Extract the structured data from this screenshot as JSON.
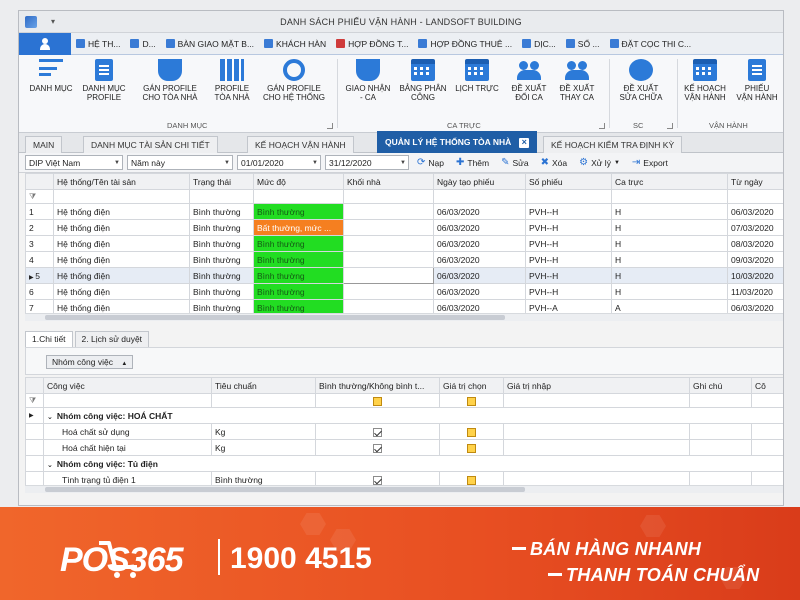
{
  "window": {
    "title": "DANH SÁCH PHIẾU VẬN HÀNH - LANDSOFT BUILDING"
  },
  "ribbon_tabs": [
    {
      "label": "HỆ TH..."
    },
    {
      "label": "D..."
    },
    {
      "label": "BÀN GIAO MẶT B..."
    },
    {
      "label": "KHÁCH HÀN"
    },
    {
      "label": "HỢP ĐỒNG T..."
    },
    {
      "label": "HỢP ĐỒNG THUÊ ..."
    },
    {
      "label": "DỊC..."
    },
    {
      "label": "SỔ ..."
    },
    {
      "label": "ĐẶT CỌC THI C..."
    }
  ],
  "ribbon": {
    "danh_muc": "DANH MỤC",
    "danh_muc_profile": [
      "DANH MỤC",
      "PROFILE"
    ],
    "gan_profile_toa_nha": [
      "GÁN PROFILE",
      "CHO TÒA NHÀ"
    ],
    "profile_toa_nha": [
      "PROFILE",
      "TÒA NHÀ"
    ],
    "gan_profile_he_thong": [
      "GÁN PROFILE",
      "CHO HỆ THỐNG"
    ],
    "giao_nhan_ca": [
      "GIAO NHẬN",
      "- CA"
    ],
    "bang_phan_cong": [
      "BẢNG PHÂN",
      "CÔNG"
    ],
    "lich_truc": "LỊCH TRỰC",
    "de_xuat_doi_ca": [
      "ĐỀ XUẤT",
      "ĐỔI CA"
    ],
    "de_xuat_thay_ca": [
      "ĐỀ XUẤT",
      "THAY CA"
    ],
    "de_xuat_sua_chua": [
      "ĐỀ XUẤT",
      "SỬA CHỮA"
    ],
    "ke_hoach_van_hanh": [
      "KẾ HOẠCH",
      "VẬN HÀNH"
    ],
    "phieu_van_hanh": [
      "PHIẾU",
      "VẬN HÀNH"
    ],
    "groups": {
      "danh_muc": "DANH MỤC",
      "ca_truc": "CA TRỰC",
      "sc": "SC",
      "van_hanh": "VẬN HÀNH"
    }
  },
  "doc_tabs": [
    {
      "label": "MAIN"
    },
    {
      "label": "DANH MỤC TÀI SẢN CHI TIẾT"
    },
    {
      "label": "KẾ HOẠCH VẬN HÀNH"
    },
    {
      "label": "QUẢN LÝ HỆ THỐNG TÒA NHÀ"
    },
    {
      "label": "KẾ HOẠCH KIỂM TRA ĐỊNH KỲ"
    }
  ],
  "filter": {
    "building": "DIP Việt Nam",
    "period": "Năm này",
    "from": "01/01/2020",
    "to": "31/12/2020",
    "nap": "Nạp",
    "them": "Thêm",
    "sua": "Sửa",
    "xoa": "Xóa",
    "xu_ly": "Xử lý",
    "export": "Export"
  },
  "grid1": {
    "columns": [
      "Hệ thống/Tên tài sản",
      "Trạng thái",
      "Mức độ",
      "Khối nhà",
      "Ngày tạo phiếu",
      "Số phiếu",
      "Ca trực",
      "Từ ngày"
    ],
    "rows": [
      {
        "n": "1",
        "name": "Hệ thống điện",
        "status": "Bình thường",
        "level": "Bình thường",
        "level_color": "green",
        "block": "",
        "date": "06/03/2020",
        "code": "PVH--H",
        "shift": "H",
        "from": "06/03/2020"
      },
      {
        "n": "2",
        "name": "Hệ thống điện",
        "status": "Bình thường",
        "level": "Bất thường, mức ...",
        "level_color": "orange",
        "block": "",
        "date": "06/03/2020",
        "code": "PVH--H",
        "shift": "H",
        "from": "07/03/2020"
      },
      {
        "n": "3",
        "name": "Hệ thống điện",
        "status": "Bình thường",
        "level": "Bình thường",
        "level_color": "green",
        "block": "",
        "date": "06/03/2020",
        "code": "PVH--H",
        "shift": "H",
        "from": "08/03/2020"
      },
      {
        "n": "4",
        "name": "Hệ thống điện",
        "status": "Bình thường",
        "level": "Bình thường",
        "level_color": "green",
        "block": "",
        "date": "06/03/2020",
        "code": "PVH--H",
        "shift": "H",
        "from": "09/03/2020"
      },
      {
        "n": "5",
        "name": "Hệ thống điện",
        "status": "Bình thường",
        "level": "Bình thường",
        "level_color": "green",
        "block": "",
        "date": "06/03/2020",
        "code": "PVH--H",
        "shift": "H",
        "from": "10/03/2020"
      },
      {
        "n": "6",
        "name": "Hệ thống điện",
        "status": "Bình thường",
        "level": "Bình thường",
        "level_color": "green",
        "block": "",
        "date": "06/03/2020",
        "code": "PVH--H",
        "shift": "H",
        "from": "11/03/2020"
      },
      {
        "n": "7",
        "name": "Hệ thống điện",
        "status": "Bình thường",
        "level": "Bình thường",
        "level_color": "green",
        "block": "",
        "date": "06/03/2020",
        "code": "PVH--A",
        "shift": "A",
        "from": "06/03/2020"
      }
    ]
  },
  "detail_tabs": [
    "1.Chi tiết",
    "2. Lịch sử duyệt"
  ],
  "group_chip": "Nhóm công việc",
  "grid2": {
    "columns": [
      "Công việc",
      "Tiêu chuẩn",
      "Bình thường/Không bình t...",
      "Giá trị chọn",
      "Giá trị nhập",
      "Ghi chú",
      "Cô"
    ],
    "groups": [
      {
        "title": "Nhóm công việc: HOÁ CHẤT",
        "items": [
          {
            "task": "Hoá chất sử dụng",
            "std": "Kg"
          },
          {
            "task": "Hoá chất hiện tại",
            "std": "Kg"
          }
        ]
      },
      {
        "title": "Nhóm công việc: Tủ điện",
        "items": [
          {
            "task": "Tình trạng tủ điện 1",
            "std": "Bình thường"
          }
        ]
      }
    ]
  },
  "footer": {
    "brand": "POS365",
    "phone": "1900 4515",
    "slogan1": "BÁN HÀNG NHANH",
    "slogan2": "THANH TOÁN CHUẨN"
  },
  "colors": {
    "accent": "#2b73d3",
    "active_tab": "#1f5ea6",
    "ok": "#22dd22",
    "warn": "#f57f20",
    "footer": "#e84f22"
  }
}
